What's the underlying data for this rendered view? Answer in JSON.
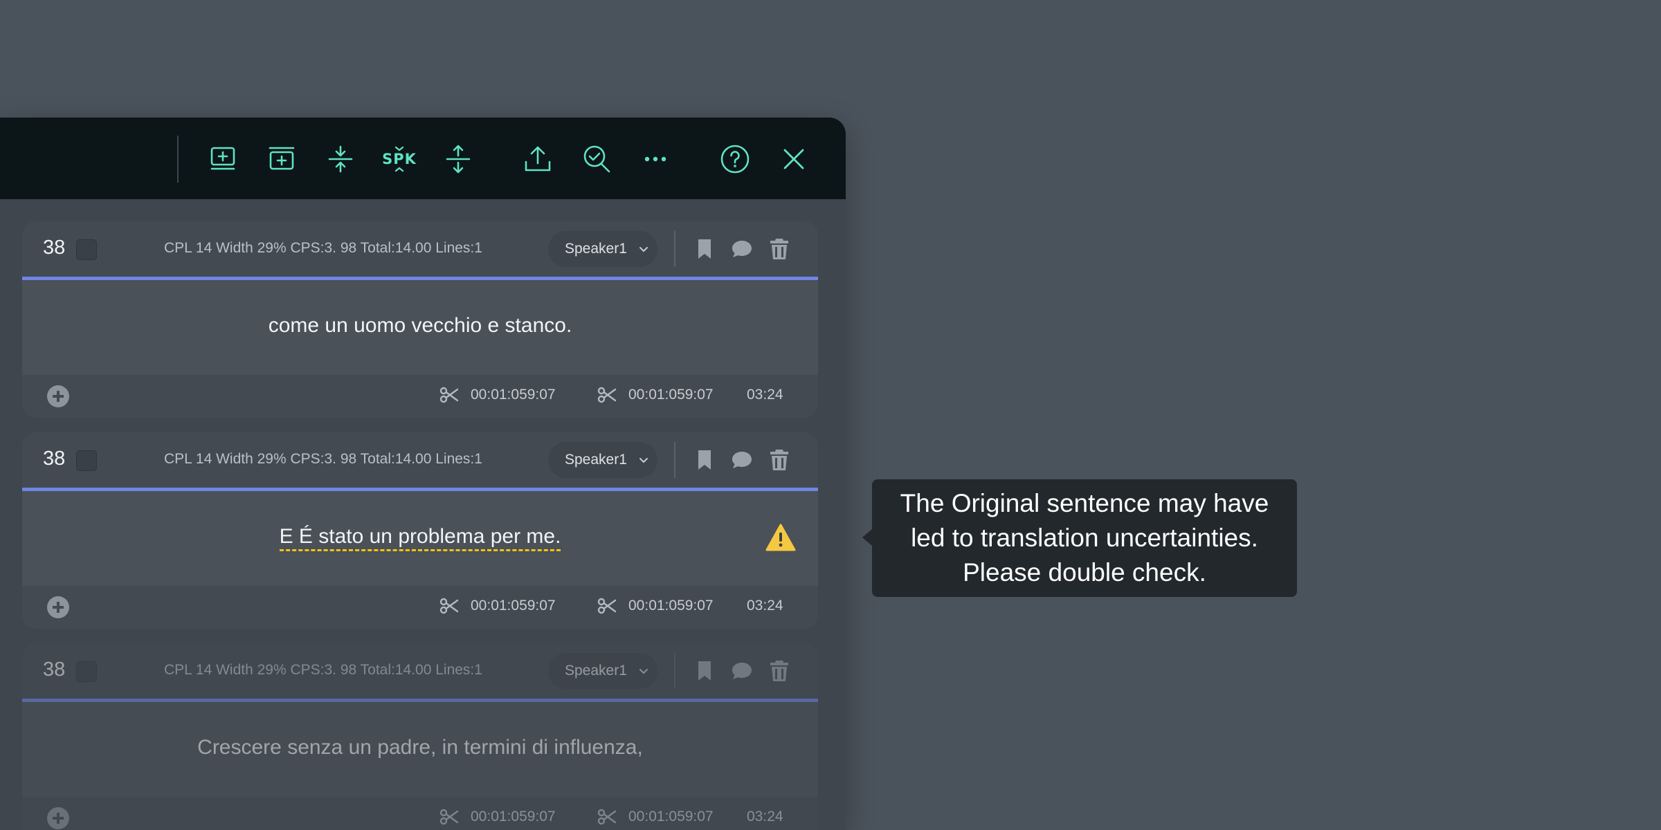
{
  "toolbar": {
    "buttons": [
      {
        "name": "add-subtitle-below-button",
        "icon": "monitor-plus-icon"
      },
      {
        "name": "insert-subtitle-button",
        "icon": "box-plus-icon"
      },
      {
        "name": "merge-button",
        "icon": "merge-arrows-icon"
      },
      {
        "name": "speaker-split-button",
        "label": "SPK"
      },
      {
        "name": "split-button",
        "icon": "split-arrows-icon"
      },
      {
        "name": "export-button",
        "icon": "upload-icon"
      },
      {
        "name": "quality-check-button",
        "icon": "search-check-icon"
      },
      {
        "name": "more-button",
        "icon": "more-dots-icon"
      },
      {
        "name": "help-button",
        "icon": "help-circle-icon"
      },
      {
        "name": "close-button",
        "icon": "close-icon"
      }
    ],
    "spk_label": "SPK"
  },
  "cards": [
    {
      "number": "38",
      "stats": "CPL 14 Width 29% CPS:3. 98 Total:14.00 Lines:1",
      "speaker": "Speaker1",
      "text": "come un uomo vecchio e stanco.",
      "time_in": "00:01:059:07",
      "time_out": "00:01:059:07",
      "duration": "03:24"
    },
    {
      "number": "38",
      "stats": "CPL 14 Width 29% CPS:3. 98 Total:14.00 Lines:1",
      "speaker": "Speaker1",
      "text": "E É stato un problema per me.",
      "time_in": "00:01:059:07",
      "time_out": "00:01:059:07",
      "duration": "03:24",
      "warning": true
    },
    {
      "number": "38",
      "stats": "CPL 14 Width 29% CPS:3. 98 Total:14.00 Lines:1",
      "speaker": "Speaker1",
      "text": "Crescere senza un padre, in termini di influenza,",
      "time_in": "00:01:059:07",
      "time_out": "00:01:059:07",
      "duration": "03:24"
    }
  ],
  "tooltip": {
    "line1": "The Original sentence may have",
    "line2": "led to translation uncertainties.",
    "line3": "Please double check."
  },
  "colors": {
    "accent": "#5fe3c3",
    "divider": "#6f85e6",
    "warning": "#f1c40f",
    "background": "#4a525b"
  }
}
